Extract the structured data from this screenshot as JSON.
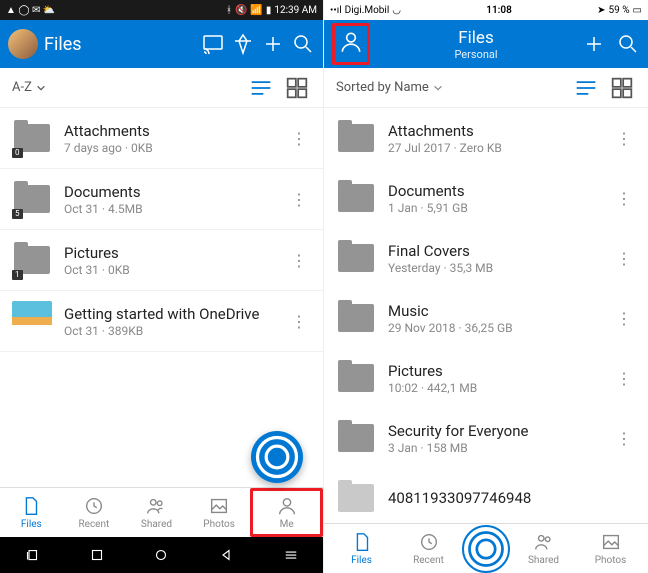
{
  "left": {
    "status_time": "12:39 AM",
    "title": "Files",
    "sort": "A-Z",
    "items": [
      {
        "name": "Attachments",
        "meta": "7 days ago · 0KB",
        "badge": "0"
      },
      {
        "name": "Documents",
        "meta": "Oct 31 · 4.5MB",
        "badge": "5"
      },
      {
        "name": "Pictures",
        "meta": "Oct 31 · 0KB",
        "badge": "1"
      },
      {
        "name": "Getting started with OneDrive",
        "meta": "Oct 31 · 389KB",
        "badge": ""
      }
    ],
    "tabs": {
      "files": "Files",
      "recent": "Recent",
      "shared": "Shared",
      "photos": "Photos",
      "me": "Me"
    }
  },
  "right": {
    "carrier": "Digi.Mobil",
    "status_time": "11:08",
    "battery": "59 %",
    "title": "Files",
    "subtitle": "Personal",
    "sort": "Sorted by Name",
    "items": [
      {
        "name": "Attachments",
        "meta": "27 Jul 2017 · Zero KB"
      },
      {
        "name": "Documents",
        "meta": "1 Jan · 5,91 GB"
      },
      {
        "name": "Final Covers",
        "meta": "Yesterday · 35,3 MB"
      },
      {
        "name": "Music",
        "meta": "29 Nov 2018 · 36,25 GB"
      },
      {
        "name": "Pictures",
        "meta": "10:02 · 442,1 MB"
      },
      {
        "name": "Security for Everyone",
        "meta": "3 Jan · 158 MB"
      },
      {
        "name": "40811933097746948",
        "meta": ""
      }
    ],
    "tabs": {
      "files": "Files",
      "recent": "Recent",
      "shared": "Shared",
      "photos": "Photos"
    }
  }
}
